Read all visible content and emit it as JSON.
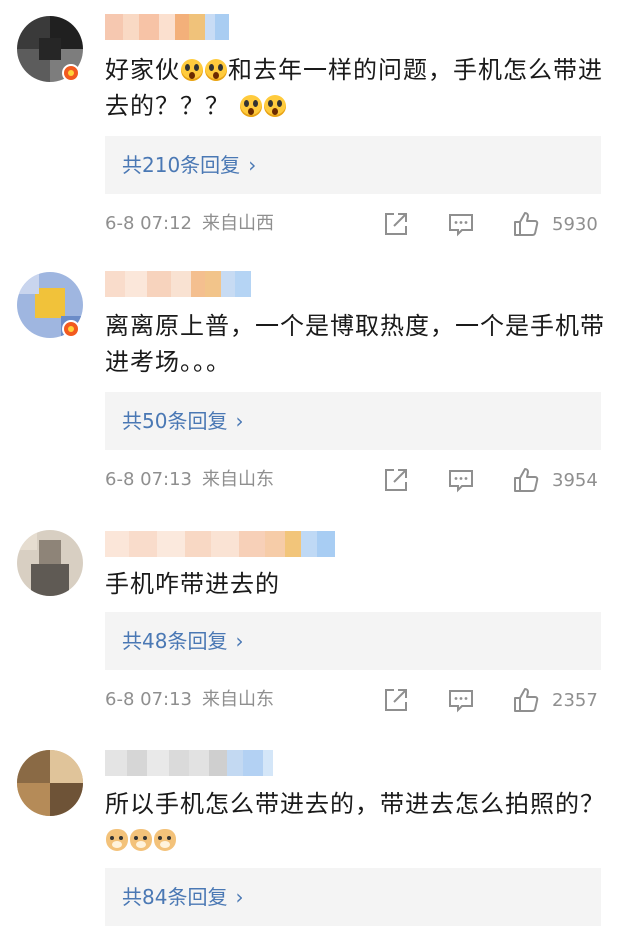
{
  "comments": [
    {
      "avatar_colors": [
        "#3a3a3a",
        "#202020",
        "#5c5c5c",
        "#7d7d7d",
        "#262626",
        "#c85a2a"
      ],
      "text_parts": [
        "好家伙",
        "shock",
        "shock",
        "和去年一样的问题，手机怎么带进去的？？？ ",
        "shock",
        "shock"
      ],
      "replies_label": "共210条回复",
      "date": "6-8 07:12",
      "location": "来自山西",
      "likes": "5930"
    },
    {
      "avatar_colors": [
        "#9fb6e0",
        "#f1c23a",
        "#6b8cc8",
        "#f4d56a",
        "#c9d5ee",
        "#5a7fc0"
      ],
      "text_parts": [
        "离离原上普，一个是博取热度，一个是手机带进考场。。。"
      ],
      "replies_label": "共50条回复",
      "date": "6-8 07:13",
      "location": "来自山东",
      "likes": "3954"
    },
    {
      "avatar_colors": [
        "#d8cfc2",
        "#8e8478",
        "#b9a894",
        "#5f5a54",
        "#e6ddd0",
        "#a39685"
      ],
      "text_parts": [
        "手机咋带进去的"
      ],
      "replies_label": "共48条回复",
      "date": "6-8 07:13",
      "location": "来自山东",
      "likes": "2357"
    },
    {
      "avatar_colors": [
        "#c9a679",
        "#8a6a45",
        "#e0c49a",
        "#6e5337",
        "#b58b58",
        "#d8b487"
      ],
      "text_parts": [
        "所以手机怎么带进去的，带进去怎么拍照的？",
        "doge",
        "doge",
        "doge"
      ],
      "replies_label": "共84条回复"
    }
  ],
  "icons": {
    "share": "share-icon",
    "comment": "comment-icon",
    "like": "like-icon",
    "chevron": "›"
  },
  "colors": {
    "link": "#4a78b4",
    "meta": "#8f8f8f",
    "reply_bg": "#f4f4f4"
  }
}
